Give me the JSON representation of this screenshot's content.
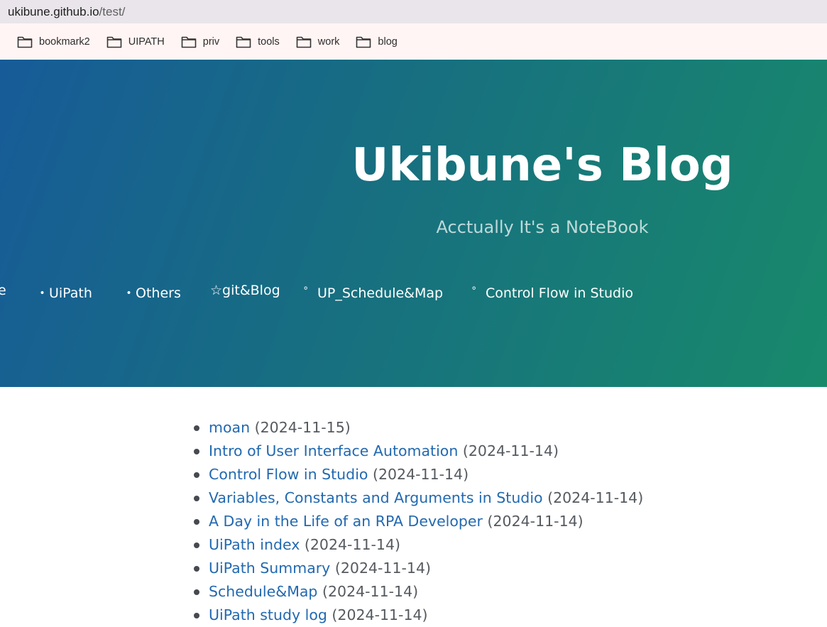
{
  "browser": {
    "url_host": "ukibune.github.io",
    "url_path": "/test/",
    "bookmarks": [
      {
        "label": "bookmark2",
        "icon": "folder-icon"
      },
      {
        "label": "UIPATH",
        "icon": "folder-icon"
      },
      {
        "label": "priv",
        "icon": "folder-icon"
      },
      {
        "label": "tools",
        "icon": "folder-icon"
      },
      {
        "label": "work",
        "icon": "folder-icon"
      },
      {
        "label": "blog",
        "icon": "folder-icon"
      }
    ]
  },
  "hero": {
    "title": "Ukibune's Blog",
    "subtitle": "Acctually It's a NoteBook",
    "nav": [
      "e",
      "・UiPath",
      "・Others",
      "☆git&Blog",
      "゜UP_Schedule&Map",
      "゜Control Flow in Studio"
    ]
  },
  "posts": [
    {
      "title": "moan",
      "date": "(2024-11-15)"
    },
    {
      "title": "Intro of User Interface Automation",
      "date": "(2024-11-14)"
    },
    {
      "title": "Control Flow in Studio",
      "date": "(2024-11-14)"
    },
    {
      "title": "Variables, Constants and Arguments in Studio",
      "date": "(2024-11-14)"
    },
    {
      "title": "A Day in the Life of an RPA Developer",
      "date": "(2024-11-14)"
    },
    {
      "title": "UiPath index",
      "date": "(2024-11-14)"
    },
    {
      "title": "UiPath Summary",
      "date": "(2024-11-14)"
    },
    {
      "title": "Schedule&Map",
      "date": "(2024-11-14)"
    },
    {
      "title": "UiPath study log",
      "date": "(2024-11-14)"
    }
  ],
  "colors": {
    "hero_gradient_start": "#175b98",
    "hero_gradient_end": "#188a6b",
    "link": "#2269b0"
  }
}
